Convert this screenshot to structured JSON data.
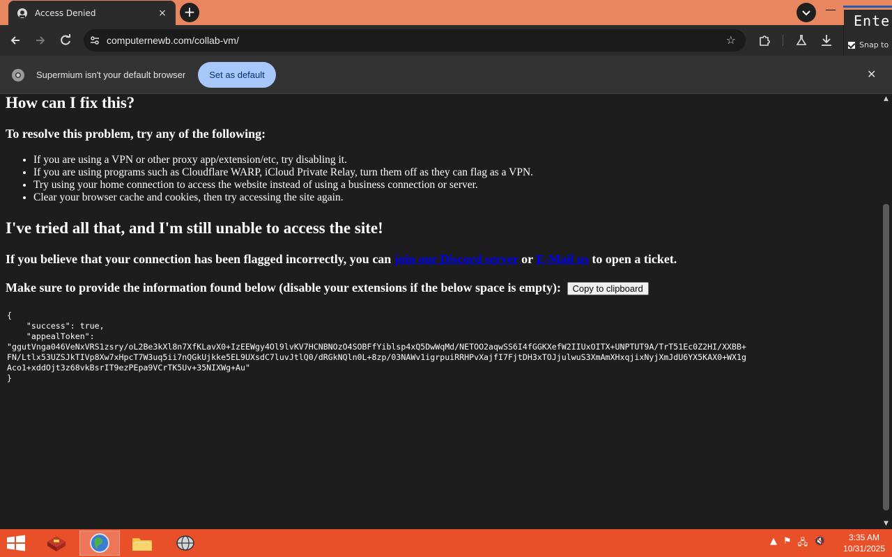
{
  "browser": {
    "tab_title": "Access Denied",
    "tab_close": "×",
    "new_tab": "+",
    "url": "computernewb.com/collab-vm/"
  },
  "overlay": {
    "enter_text": "Enter",
    "snap_text": "Snap to"
  },
  "infobar": {
    "message": "Supermium isn't your default browser",
    "button_label": "Set as default",
    "close": "✕"
  },
  "page": {
    "heading_fix": "How can I fix this?",
    "heading_resolve": "To resolve this problem, try any of the following:",
    "tips": [
      "If you are using a VPN or other proxy app/extension/etc, try disabling it.",
      "If you are using programs such as Cloudflare WARP, iCloud Private Relay, turn them off as they can flag as a VPN.",
      "Try using your home connection to access the website instead of using a business connection or server.",
      "Clear your browser cache and cookies, then try accessing the site again."
    ],
    "heading_tried": "I've tried all that, and I'm still unable to access the site!",
    "believe_prefix": "If you believe that your connection has been flagged incorrectly, you can ",
    "discord_link": "join our Discord server",
    "believe_or": " or ",
    "email_link": "E-Mail us",
    "believe_suffix": " to open a ticket.",
    "make_sure": "Make sure to provide the information found below (disable your extensions if the below space is empty):",
    "copy_button": "Copy to clipboard",
    "token_block": "{\n    \"success\": true,\n    \"appealToken\":\n\"ggutVnga046VeNxVRS1zsry/oL2Be3kXl8n7XfKLavX0+IzEEWgy4Ol9lvKV7HCNBNOzO4SOBFfYiblsp4xQ5DwWqMd/NETOO2aqwSS6I4fGGKXefW2IIUxOITX+UNPTUT9A/TrT51Ec0Z2HI/XXBB+\nFN/Ltlx53UZSJkTIVp8Xw7xHpcT7W3uq5ii7nQGkUjkke5EL9UXsdC7luvJtlQ0/dRGkNQln0L+8zp/03NAWv1igrpuiRRHPvXajfI7FjtDH3xTOJjulwuS3XmAmXHxqjixNyjXmJdU6YX5KAX0+WX1g\nAco1+xddOjt3z68vkBsrIT9ezPEpa9VCrTK5Uv+35NIXWg+Au\"\n}"
  },
  "taskbar": {
    "time": "3:35 AM",
    "date": "10/31/2025"
  },
  "colors": {
    "titlebar": "#e8875f",
    "taskbar": "#e8502a",
    "page_bg": "#1d1d1d",
    "link": "#0000ee",
    "default_button": "#a8c7fa"
  }
}
